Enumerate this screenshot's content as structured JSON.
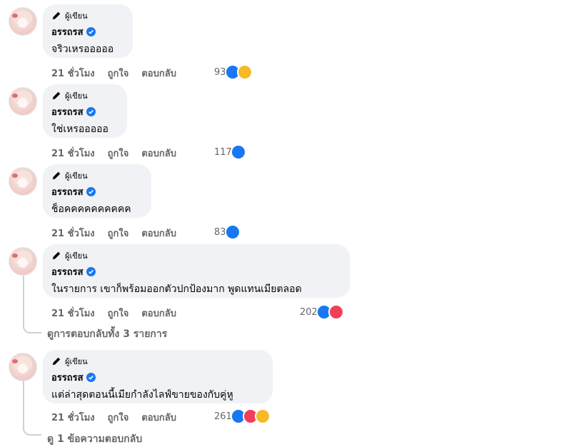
{
  "author_badge_label": "ผู้เขียน",
  "comments": [
    {
      "name": "อรรถรส",
      "text": "จริวเหรอออออ",
      "time": "21 ชั่วโมง",
      "like": "ถูกใจ",
      "reply": "ตอบกลับ",
      "count": "93",
      "reactions": [
        "like",
        "haha"
      ]
    },
    {
      "name": "อรรถรส",
      "text": "ใช่เหรอออออ",
      "time": "21 ชั่วโมง",
      "like": "ถูกใจ",
      "reply": "ตอบกลับ",
      "count": "117",
      "reactions": [
        "like"
      ]
    },
    {
      "name": "อรรถรส",
      "text": "ช็อคคคคคคคคคค",
      "time": "21 ชั่วโมง",
      "like": "ถูกใจ",
      "reply": "ตอบกลับ",
      "count": "83",
      "reactions": [
        "like"
      ]
    },
    {
      "name": "อรรถรส",
      "text": "ในรายการ เขาก็พร้อมออกตัวปกป้องมาก พูดแทนเมียตลอด",
      "time": "21 ชั่วโมง",
      "like": "ถูกใจ",
      "reply": "ตอบกลับ",
      "count": "202",
      "reactions": [
        "like",
        "love"
      ]
    },
    {
      "name": "อรรถรส",
      "text": "แต่ล่าสุดตอนนี้เมียกำลังไลฟ์ขายของกับคู่หู",
      "time": "21 ชั่วโมง",
      "like": "ถูกใจ",
      "reply": "ตอบกลับ",
      "count": "261",
      "reactions": [
        "like",
        "love",
        "care"
      ]
    }
  ],
  "view_replies_label": "ดูการตอบกลับทั้ง 3 รายการ",
  "bottom_partial_label": "ดู 1 ข้อความตอบกลับ",
  "colors": {
    "like": "#1877f2",
    "love": "#f33e58",
    "haha": "#f7b928",
    "care": "#f7b928",
    "bubble": "#f0f2f5",
    "meta": "#65676b"
  }
}
